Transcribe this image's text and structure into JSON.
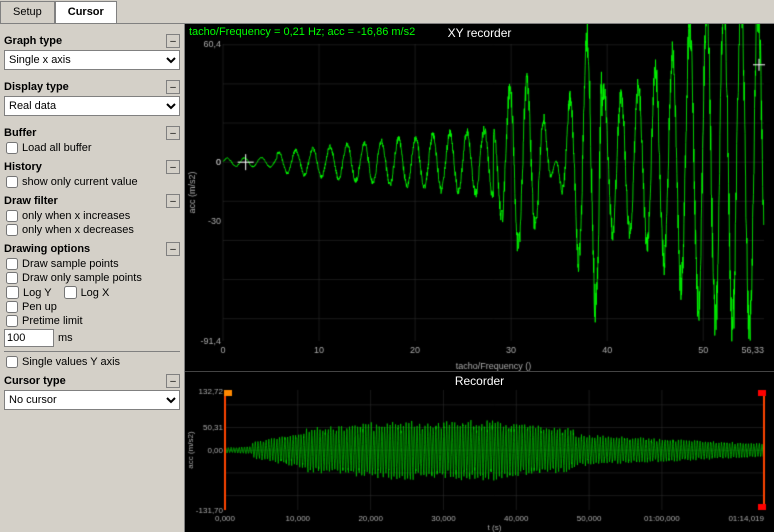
{
  "tabs": [
    {
      "label": "Setup",
      "active": false
    },
    {
      "label": "Cursor",
      "active": true
    }
  ],
  "sidebar": {
    "graph_type": {
      "title": "Graph type",
      "value": "Single x axis"
    },
    "display_type": {
      "title": "Display type",
      "value": "Real data"
    },
    "buffer": {
      "title": "Buffer",
      "load_all_label": "Load all buffer"
    },
    "history": {
      "title": "History",
      "show_only_current_label": "show only current value"
    },
    "draw_filter": {
      "title": "Draw filter",
      "only_when_x_increases": "only when x increases",
      "only_when_x_decreases": "only when x decreases"
    },
    "drawing_options": {
      "title": "Drawing options",
      "draw_sample_points": "Draw sample points",
      "draw_only_sample_points": "Draw only sample points",
      "log_y": "Log Y",
      "log_x": "Log X",
      "pen_up": "Pen up",
      "pretime_limit": "Pretime limit",
      "pretime_value": "100",
      "ms_label": "ms",
      "single_values_y": "Single values Y axis"
    },
    "cursor_type": {
      "title": "Cursor type",
      "value": "No cursor"
    }
  },
  "charts": {
    "top": {
      "title": "XY recorder",
      "info": "tacho/Frequency = 0,21 Hz; acc = -16,86 m/s2",
      "y_axis_label": "acc (m/s2)",
      "x_axis_label": "tacho/Frequency ()",
      "y_max": "60,4",
      "y_zero": "0",
      "y_min": "-91,4",
      "x_max": "56,33"
    },
    "bottom": {
      "title": "Recorder",
      "y_axis_label": "acc (m/s2)",
      "x_axis_label": "t (s)",
      "y_top": "132,72",
      "y_mid_top": "50,31",
      "y_mid_bot": "0,00",
      "y_bottom": "-131,70",
      "x_end": "01:14,019",
      "x_labels": [
        "0,000",
        "10,000",
        "20,000",
        "30,000",
        "40,000",
        "50,000",
        "01:00,000"
      ]
    }
  }
}
